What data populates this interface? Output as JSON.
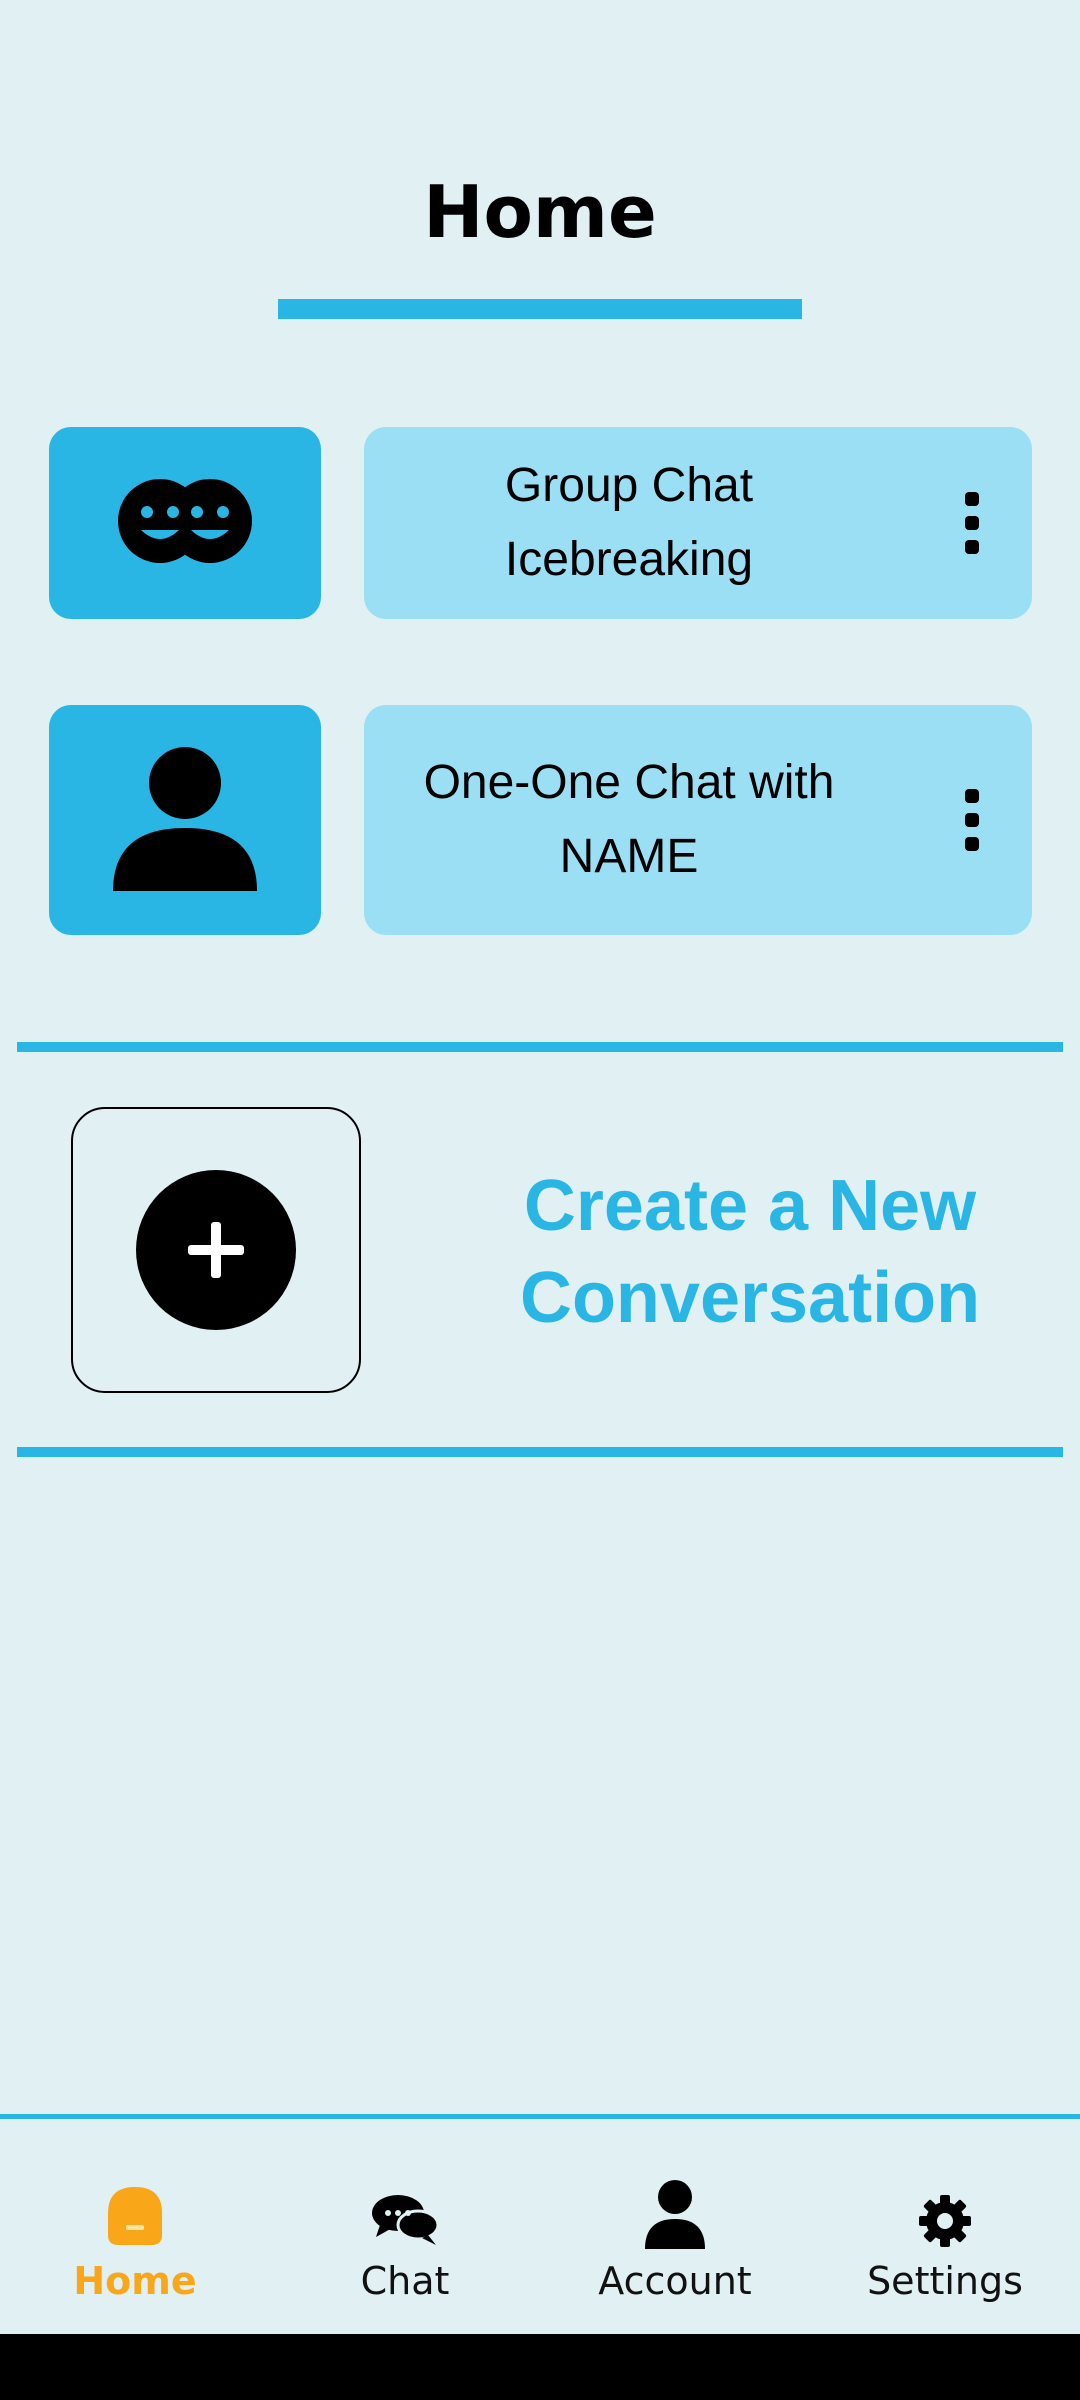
{
  "header": {
    "title": "Home"
  },
  "conversations": [
    {
      "label": "Group Chat Icebreaking",
      "icon": "group-smile-icon"
    },
    {
      "label": "One-One Chat with NAME",
      "icon": "person-icon"
    }
  ],
  "create": {
    "label": "Create a New Conversation",
    "icon": "plus-circle-icon"
  },
  "bottom_nav": {
    "items": [
      {
        "label": "Home",
        "icon": "home-icon",
        "active": true
      },
      {
        "label": "Chat",
        "icon": "chat-bubbles-icon",
        "active": false
      },
      {
        "label": "Account",
        "icon": "account-icon",
        "active": false
      },
      {
        "label": "Settings",
        "icon": "gear-icon",
        "active": false
      }
    ]
  },
  "colors": {
    "background": "#e1f0f3",
    "accent": "#29b6e4",
    "card": "#9adff3",
    "active_nav": "#f9a618"
  }
}
